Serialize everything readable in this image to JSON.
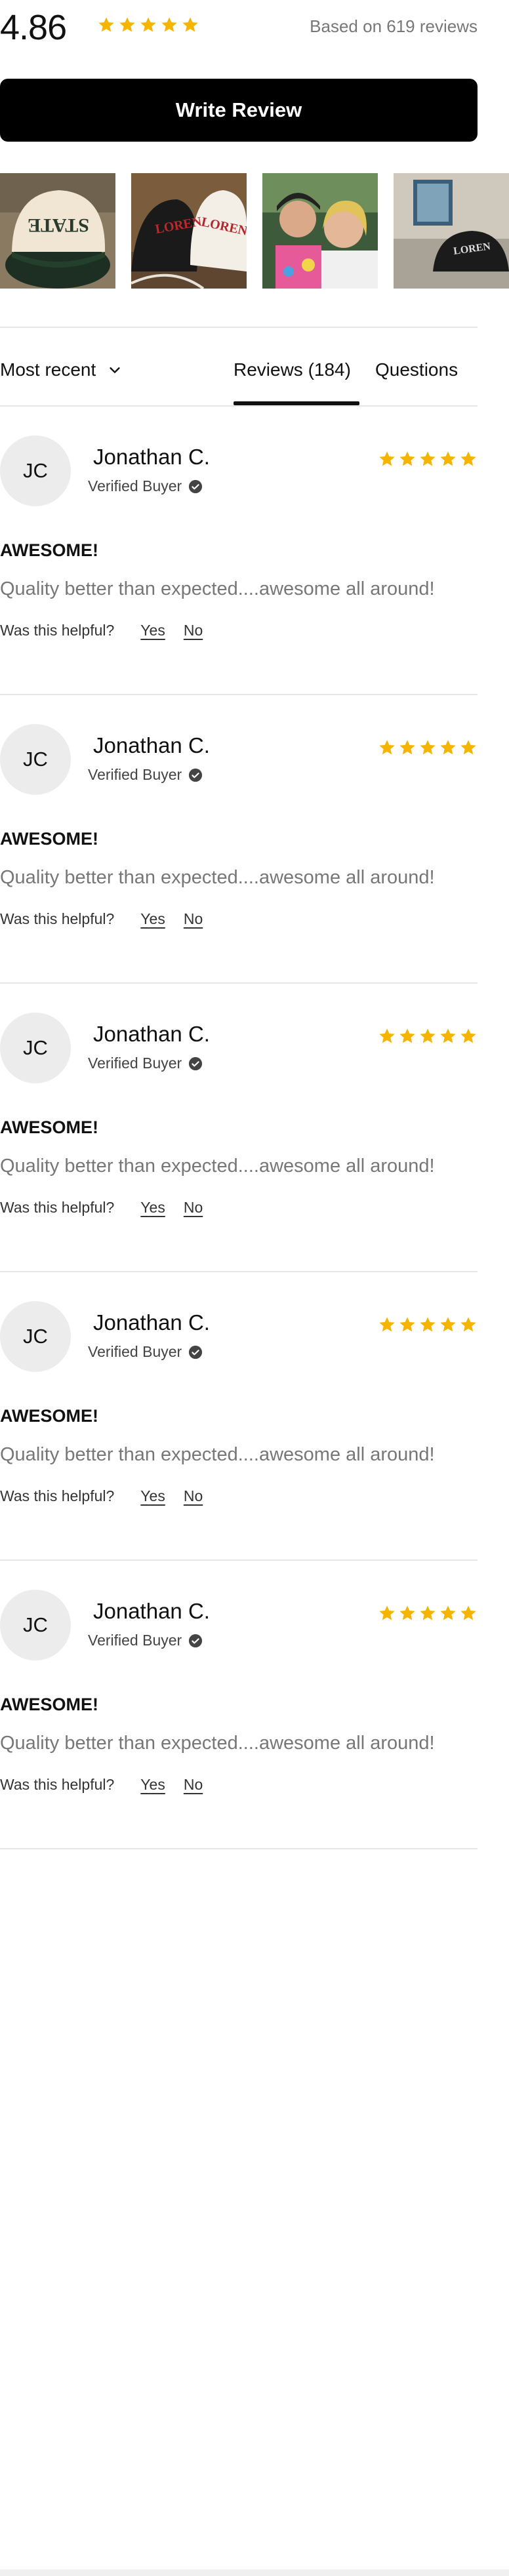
{
  "rating": {
    "score": "4.86",
    "count_text": "Based on 619 reviews",
    "star_color": "#F5B400"
  },
  "write_review_label": "Write Review",
  "photos": [
    {
      "name": "photo-cream-state-cap",
      "text": "STATE"
    },
    {
      "name": "photo-two-caps",
      "text": "LOREN"
    },
    {
      "name": "photo-selfie-women",
      "text": ""
    },
    {
      "name": "photo-black-cap-sofa",
      "text": "LOREN"
    }
  ],
  "tabs": {
    "sort_label": "Most recent",
    "reviews_label": "Reviews (184)",
    "questions_label": "Questions"
  },
  "reviews": [
    {
      "initials": "JC",
      "name": "Jonathan C.",
      "verified": "Verified Buyer",
      "rating": 5,
      "title": "AWESOME!",
      "body": "Quality better than expected....awesome all around!",
      "helpful_q": "Was this helpful?",
      "yes": "Yes",
      "no": "No"
    },
    {
      "initials": "JC",
      "name": "Jonathan C.",
      "verified": "Verified Buyer",
      "rating": 5,
      "title": "AWESOME!",
      "body": "Quality better than expected....awesome all around!",
      "helpful_q": "Was this helpful?",
      "yes": "Yes",
      "no": "No"
    },
    {
      "initials": "JC",
      "name": "Jonathan C.",
      "verified": "Verified Buyer",
      "rating": 5,
      "title": "AWESOME!",
      "body": "Quality better than expected....awesome all around!",
      "helpful_q": "Was this helpful?",
      "yes": "Yes",
      "no": "No"
    },
    {
      "initials": "JC",
      "name": "Jonathan C.",
      "verified": "Verified Buyer",
      "rating": 5,
      "title": "AWESOME!",
      "body": "Quality better than expected....awesome all around!",
      "helpful_q": "Was this helpful?",
      "yes": "Yes",
      "no": "No"
    },
    {
      "initials": "JC",
      "name": "Jonathan C.",
      "verified": "Verified Buyer",
      "rating": 5,
      "title": "AWESOME!",
      "body": "Quality better than expected....awesome all around!",
      "helpful_q": "Was this helpful?",
      "yes": "Yes",
      "no": "No"
    }
  ]
}
